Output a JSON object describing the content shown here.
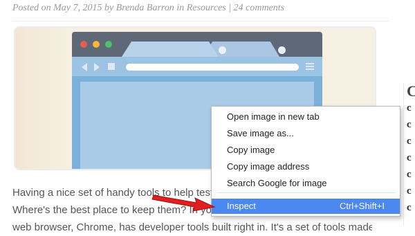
{
  "post_meta": {
    "posted_on": "Posted on",
    "date": "May 7, 2015",
    "by": "by",
    "author": "Brenda Barron",
    "in": "in",
    "category": "Resources",
    "separator": "|",
    "comments": "24 comments"
  },
  "featured_image": {
    "colors": {
      "background": "#f6f0e2",
      "frame": "#5e6877",
      "bar": "#9cc2e4",
      "content": "#7ab1db",
      "page": "#a9cbe7"
    },
    "window_dots": [
      "#e85d4e",
      "#f4b63b",
      "#4fbf6a"
    ],
    "icons": [
      "back-arrow-icon",
      "forward-arrow-icon",
      "stop-icon",
      "menu-icon"
    ]
  },
  "article": {
    "lines": [
      "Having a nice set of handy tools to help test you",
      "Where's the best place to keep them? In your b",
      "web browser, Chrome, has developer tools built right in. It's a set of tools made for"
    ]
  },
  "sidebar": {
    "letters": [
      "C",
      "c",
      "c",
      "c",
      "c",
      "c",
      "c",
      "c"
    ]
  },
  "context_menu": {
    "items": [
      "Open image in new tab",
      "Save image as...",
      "Copy image",
      "Copy image address",
      "Search Google for image"
    ],
    "highlighted": {
      "label": "Inspect",
      "shortcut": "Ctrl+Shift+I"
    },
    "highlight_color": "#4a87ee"
  },
  "annotation": {
    "arrow_color": "#e02020"
  }
}
